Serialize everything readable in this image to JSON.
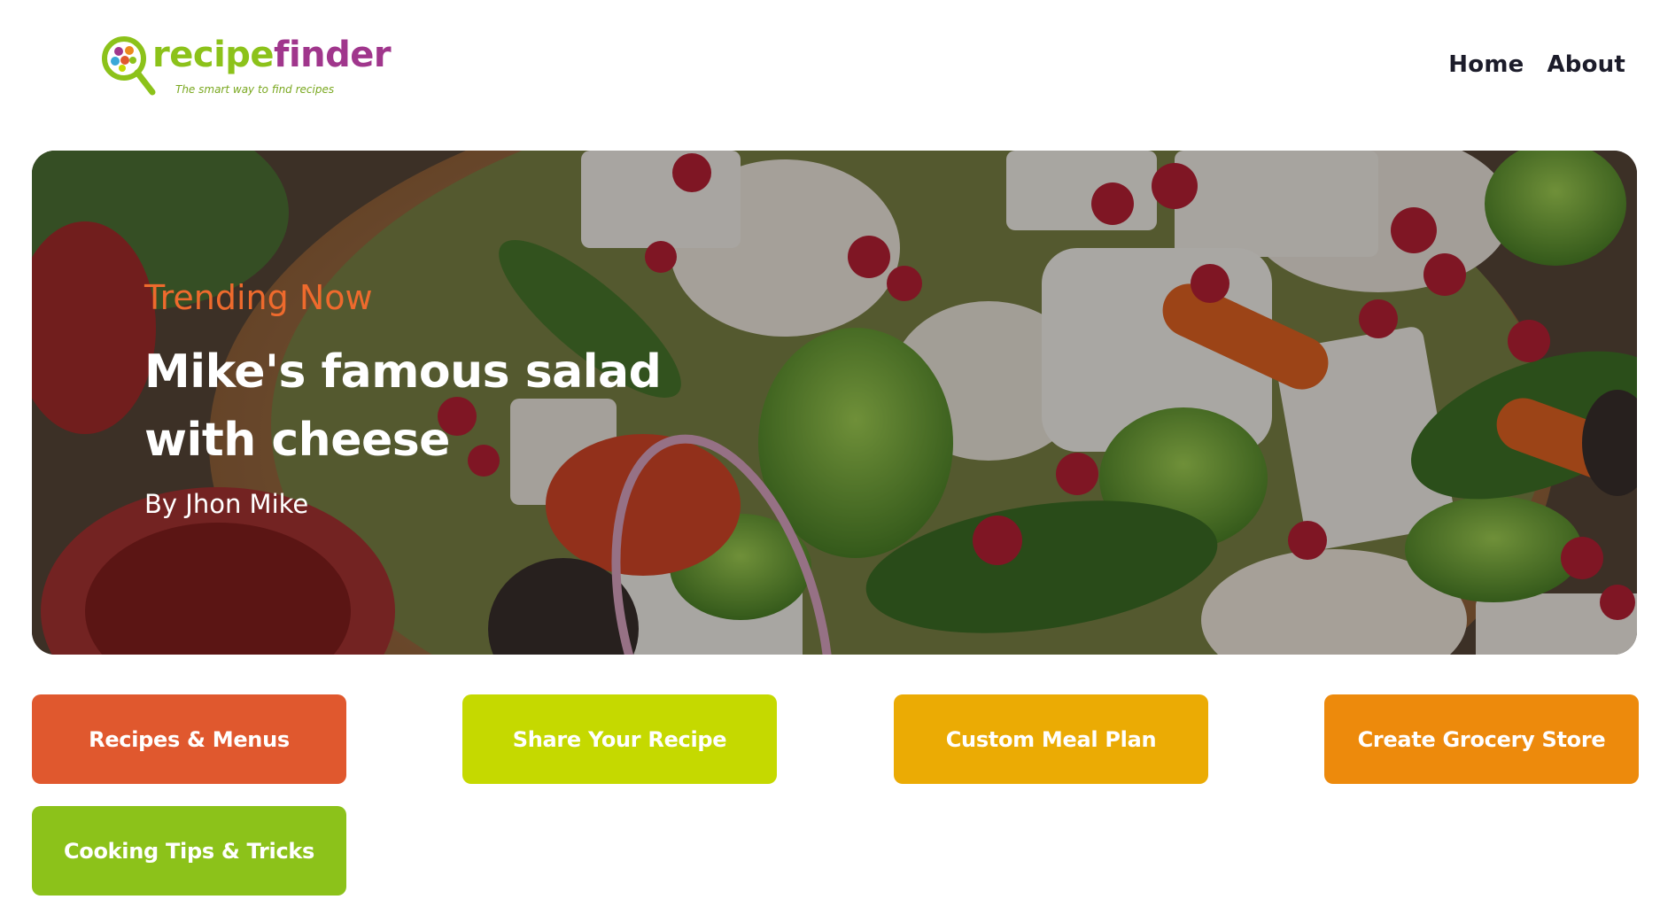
{
  "brand": {
    "name_part1": "recipe",
    "name_part2": "finder",
    "tagline": "The smart way to find recipes",
    "colors": {
      "green": "#8cc21a",
      "purple": "#a0368c"
    }
  },
  "nav": {
    "items": [
      {
        "label": "Home"
      },
      {
        "label": "About"
      }
    ]
  },
  "hero": {
    "kicker": "Trending Now",
    "title": "Mike's famous salad with cheese",
    "author": "By Jhon Mike",
    "kicker_color": "#ee6a2d"
  },
  "categories": [
    {
      "label": "Recipes & Menus",
      "color": "#e0582e"
    },
    {
      "label": "Share Your Recipe",
      "color": "#c5d900"
    },
    {
      "label": "Custom Meal Plan",
      "color": "#ebab04"
    },
    {
      "label": "Create Grocery Store",
      "color": "#ed8a0c"
    },
    {
      "label": "Cooking Tips & Tricks",
      "color": "#8cc21a"
    }
  ]
}
